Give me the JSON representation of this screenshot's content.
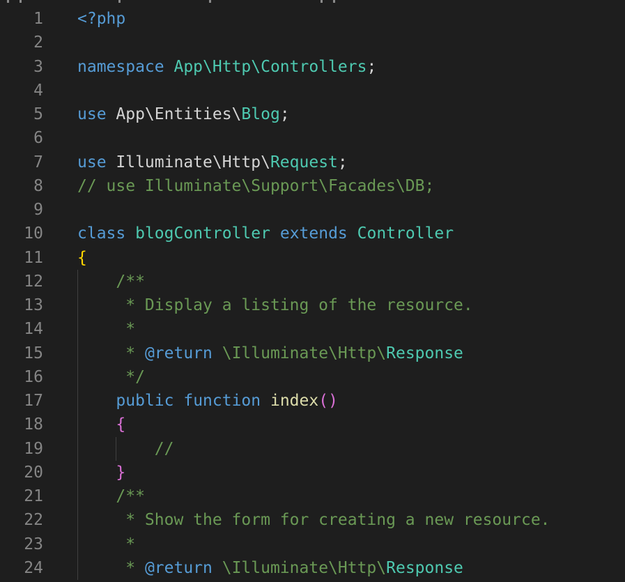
{
  "editor": {
    "language": "php",
    "theme_colors": {
      "background": "#1e1e1e",
      "line_number": "#858585",
      "keyword": "#569cd6",
      "type": "#4ec9b0",
      "comment": "#6a9955",
      "function": "#dcdcaa",
      "bracket_level1": "#ffd700",
      "bracket_level2": "#da70d6",
      "text": "#d4d4d4"
    },
    "line_numbers": [
      "1",
      "2",
      "3",
      "4",
      "5",
      "6",
      "7",
      "8",
      "9",
      "10",
      "11",
      "12",
      "13",
      "14",
      "15",
      "16",
      "17",
      "18",
      "19",
      "20",
      "21",
      "22",
      "23",
      "24"
    ],
    "lines": [
      {
        "tokens": [
          {
            "t": "<?php",
            "c": "tag"
          }
        ]
      },
      {
        "tokens": []
      },
      {
        "tokens": [
          {
            "t": "namespace",
            "c": "kw"
          },
          {
            "t": " ",
            "c": "plain"
          },
          {
            "t": "App\\Http\\Controllers",
            "c": "type"
          },
          {
            "t": ";",
            "c": "plain"
          }
        ]
      },
      {
        "tokens": []
      },
      {
        "tokens": [
          {
            "t": "use",
            "c": "kw"
          },
          {
            "t": " App\\Entities\\",
            "c": "plain"
          },
          {
            "t": "Blog",
            "c": "type"
          },
          {
            "t": ";",
            "c": "plain"
          }
        ]
      },
      {
        "tokens": []
      },
      {
        "tokens": [
          {
            "t": "use",
            "c": "kw"
          },
          {
            "t": " Illuminate\\Http\\",
            "c": "plain"
          },
          {
            "t": "Request",
            "c": "type"
          },
          {
            "t": ";",
            "c": "plain"
          }
        ]
      },
      {
        "tokens": [
          {
            "t": "// use Illuminate\\Support\\Facades\\DB;",
            "c": "cmt"
          }
        ]
      },
      {
        "tokens": []
      },
      {
        "tokens": [
          {
            "t": "class",
            "c": "kw"
          },
          {
            "t": " ",
            "c": "plain"
          },
          {
            "t": "blogController",
            "c": "type"
          },
          {
            "t": " ",
            "c": "plain"
          },
          {
            "t": "extends",
            "c": "kw"
          },
          {
            "t": " ",
            "c": "plain"
          },
          {
            "t": "Controller",
            "c": "type"
          }
        ]
      },
      {
        "tokens": [
          {
            "t": "{",
            "c": "b1"
          }
        ]
      },
      {
        "tokens": [
          {
            "t": "    /**",
            "c": "cmt"
          }
        ],
        "guides": [
          "g1"
        ]
      },
      {
        "tokens": [
          {
            "t": "     * Display a listing of the resource.",
            "c": "cmt"
          }
        ],
        "guides": [
          "g1"
        ]
      },
      {
        "tokens": [
          {
            "t": "     *",
            "c": "cmt"
          }
        ],
        "guides": [
          "g1"
        ]
      },
      {
        "tokens": [
          {
            "t": "     * ",
            "c": "cmt"
          },
          {
            "t": "@return",
            "c": "kw"
          },
          {
            "t": " \\Illuminate\\Http\\",
            "c": "cmt"
          },
          {
            "t": "Response",
            "c": "type"
          }
        ],
        "guides": [
          "g1"
        ]
      },
      {
        "tokens": [
          {
            "t": "     */",
            "c": "cmt"
          }
        ],
        "guides": [
          "g1"
        ]
      },
      {
        "tokens": [
          {
            "t": "    ",
            "c": "plain"
          },
          {
            "t": "public",
            "c": "kw"
          },
          {
            "t": " ",
            "c": "plain"
          },
          {
            "t": "function",
            "c": "kw"
          },
          {
            "t": " ",
            "c": "plain"
          },
          {
            "t": "index",
            "c": "fn"
          },
          {
            "t": "()",
            "c": "b2"
          }
        ],
        "guides": [
          "g1"
        ]
      },
      {
        "tokens": [
          {
            "t": "    ",
            "c": "plain"
          },
          {
            "t": "{",
            "c": "b2"
          }
        ],
        "guides": [
          "g1"
        ]
      },
      {
        "tokens": [
          {
            "t": "        //",
            "c": "cmt"
          }
        ],
        "guides": [
          "g1",
          "g2"
        ]
      },
      {
        "tokens": [
          {
            "t": "    ",
            "c": "plain"
          },
          {
            "t": "}",
            "c": "b2"
          }
        ],
        "guides": [
          "g1"
        ]
      },
      {
        "tokens": [
          {
            "t": "    /**",
            "c": "cmt"
          }
        ],
        "guides": [
          "g1"
        ]
      },
      {
        "tokens": [
          {
            "t": "     * Show the form for creating a new resource.",
            "c": "cmt"
          }
        ],
        "guides": [
          "g1"
        ]
      },
      {
        "tokens": [
          {
            "t": "     *",
            "c": "cmt"
          }
        ],
        "guides": [
          "g1"
        ]
      },
      {
        "tokens": [
          {
            "t": "     * ",
            "c": "cmt"
          },
          {
            "t": "@return",
            "c": "kw"
          },
          {
            "t": " \\Illuminate\\Http\\",
            "c": "cmt"
          },
          {
            "t": "Response",
            "c": "type"
          }
        ],
        "guides": [
          "g1"
        ]
      }
    ]
  }
}
